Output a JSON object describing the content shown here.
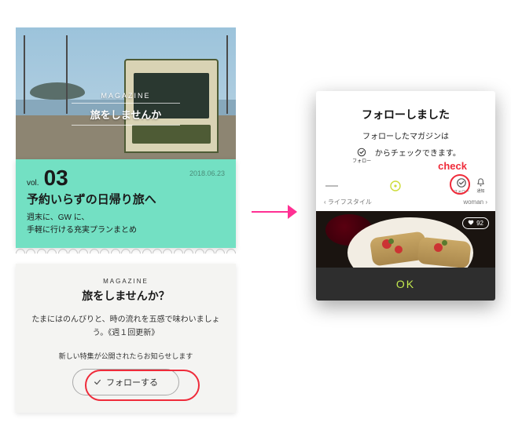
{
  "hero": {
    "magazine_label": "MAGAZINE",
    "magazine_title": "旅をしませんか"
  },
  "article": {
    "vol_label": "vol.",
    "vol_number": "03",
    "date": "2018.06.23",
    "headline": "予約いらずの日帰り旅へ",
    "lead1": "週末に、GW に、",
    "lead2": "手軽に行ける充実プランまとめ"
  },
  "promo": {
    "magazine_label": "MAGAZINE",
    "title": "旅をしませんか？",
    "body": "たまにはのんびりと、時の流れを五感で味わいましょう。《週１回更新》",
    "notify": "新しい特集が公開されたらお知らせします",
    "follow_btn": "フォローする"
  },
  "dialog": {
    "title": "フォローしました",
    "body_pre": "フォローしたマガジンは",
    "body_post": "からチェックできます。",
    "inline_caption": "フォロー",
    "check_label": "check",
    "mini": {
      "follow_caption": "フォロー",
      "note_caption": "通知",
      "crumb_left": "ライフスタイル",
      "crumb_right": "woman",
      "badge": "92"
    },
    "ok": "OK"
  }
}
